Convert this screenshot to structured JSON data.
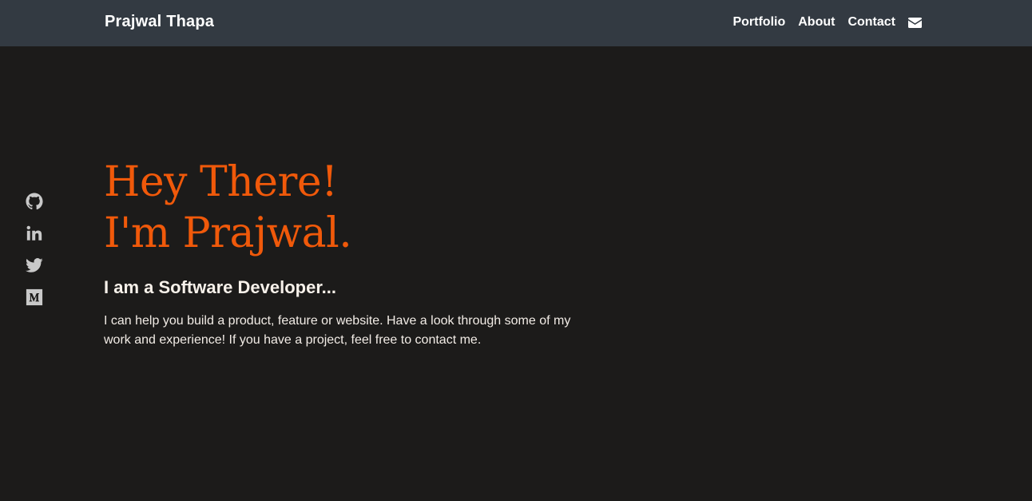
{
  "navbar": {
    "brand": "Prajwal Thapa",
    "links": [
      {
        "label": "Portfolio"
      },
      {
        "label": "About"
      },
      {
        "label": "Contact"
      }
    ],
    "mail_icon": "envelope-icon"
  },
  "social": {
    "icons": [
      "github-icon",
      "linkedin-icon",
      "twitter-icon",
      "medium-icon"
    ]
  },
  "hero": {
    "title_line1": "Hey There!",
    "title_line2": "I'm Prajwal.",
    "subtitle": "I am a Software Developer...",
    "description": "I can help you build a product, feature or website. Have a look through some of my work and experience! If you have a project, feel free to contact me."
  },
  "colors": {
    "navbar_bg": "#333a42",
    "page_bg": "#1c1b1a",
    "accent": "#f0590a",
    "text": "#f2ece6",
    "icon": "#c9c9c9"
  }
}
